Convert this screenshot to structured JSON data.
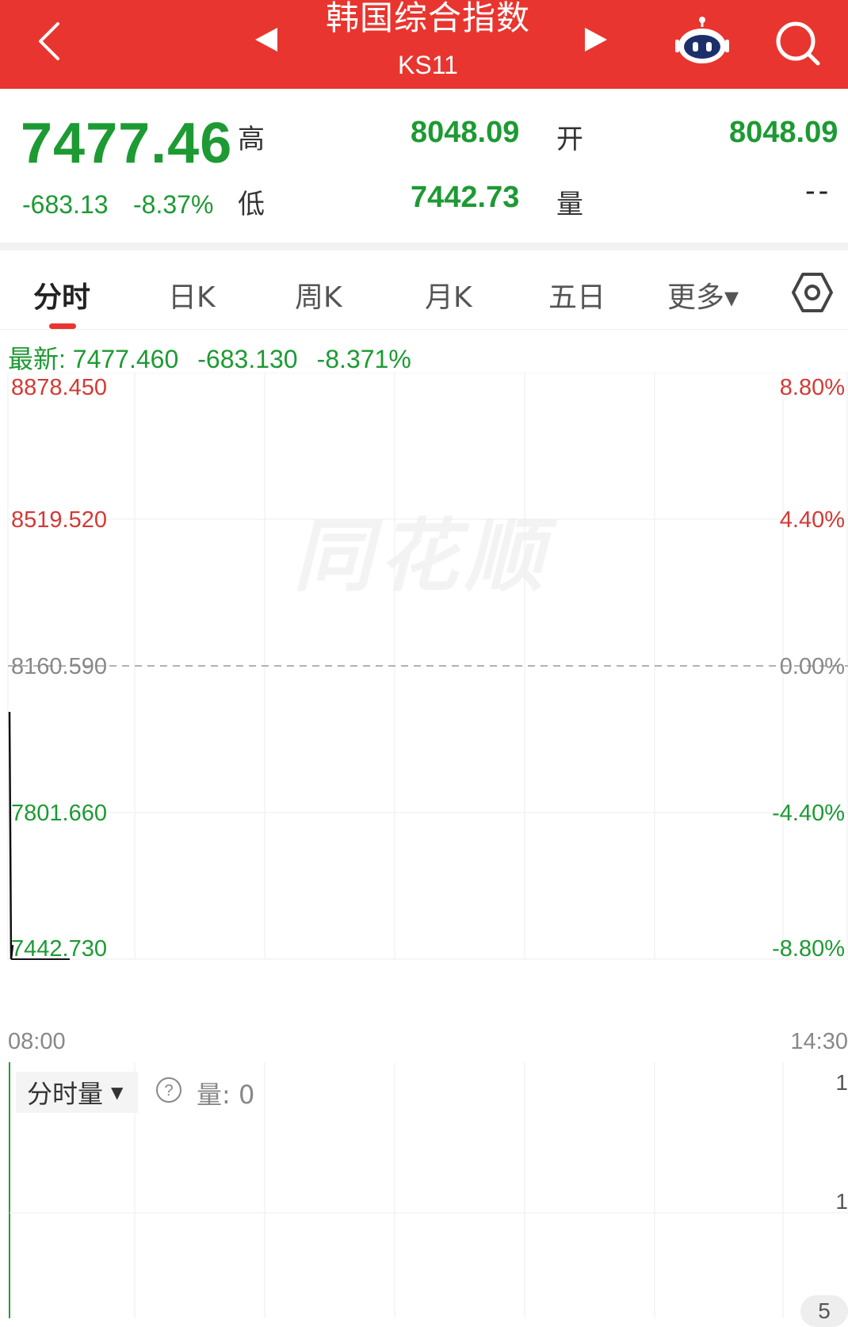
{
  "header": {
    "title": "韩国综合指数",
    "code": "KS11",
    "back_icon": "chevron-left-icon",
    "prev_icon": "triangle-left-icon",
    "next_icon": "triangle-right-icon",
    "assistant_icon": "robot-icon",
    "search_icon": "search-icon",
    "bg_color": "#e9352f"
  },
  "quote": {
    "price": "7477.46",
    "change": "-683.13",
    "change_pct": "-8.37%",
    "high_label": "高",
    "high_value": "8048.09",
    "low_label": "低",
    "low_value": "7442.73",
    "open_label": "开",
    "open_value": "8048.09",
    "volume_label": "量",
    "volume_value": "--",
    "down_color": "#1d9a33"
  },
  "tabs": {
    "items": [
      {
        "label": "分时",
        "active": true
      },
      {
        "label": "日K",
        "active": false
      },
      {
        "label": "周K",
        "active": false
      },
      {
        "label": "月K",
        "active": false
      },
      {
        "label": "五日",
        "active": false
      },
      {
        "label": "更多▾",
        "active": false
      }
    ],
    "settings_icon": "hexagon-settings-icon"
  },
  "latest": {
    "label": "最新: 7477.460",
    "change": "-683.130",
    "pct": "-8.371%"
  },
  "chart_data": {
    "type": "line",
    "y_left_ticks": [
      "8878.450",
      "8519.520",
      "8160.590",
      "7801.660",
      "7442.730"
    ],
    "y_right_ticks": [
      "8.80%",
      "4.40%",
      "0.00%",
      "-4.40%",
      "-8.80%"
    ],
    "ylim": [
      7442.73,
      8878.45
    ],
    "reference_value": 8160.59,
    "x_start_label": "08:00",
    "x_end_label": "14:30",
    "series": [
      {
        "x": [
          "08:00",
          "08:00",
          "08:00"
        ],
        "values": [
          8048.09,
          7442.73,
          7477.46
        ]
      }
    ],
    "up_color": "#d33a35",
    "down_color": "#1d9a33"
  },
  "volume": {
    "selector_label": "分时量",
    "help_icon": "question-circle-icon",
    "label": "量: 0",
    "right_top": "1",
    "right_mid": "1",
    "right_bottom": "5"
  }
}
